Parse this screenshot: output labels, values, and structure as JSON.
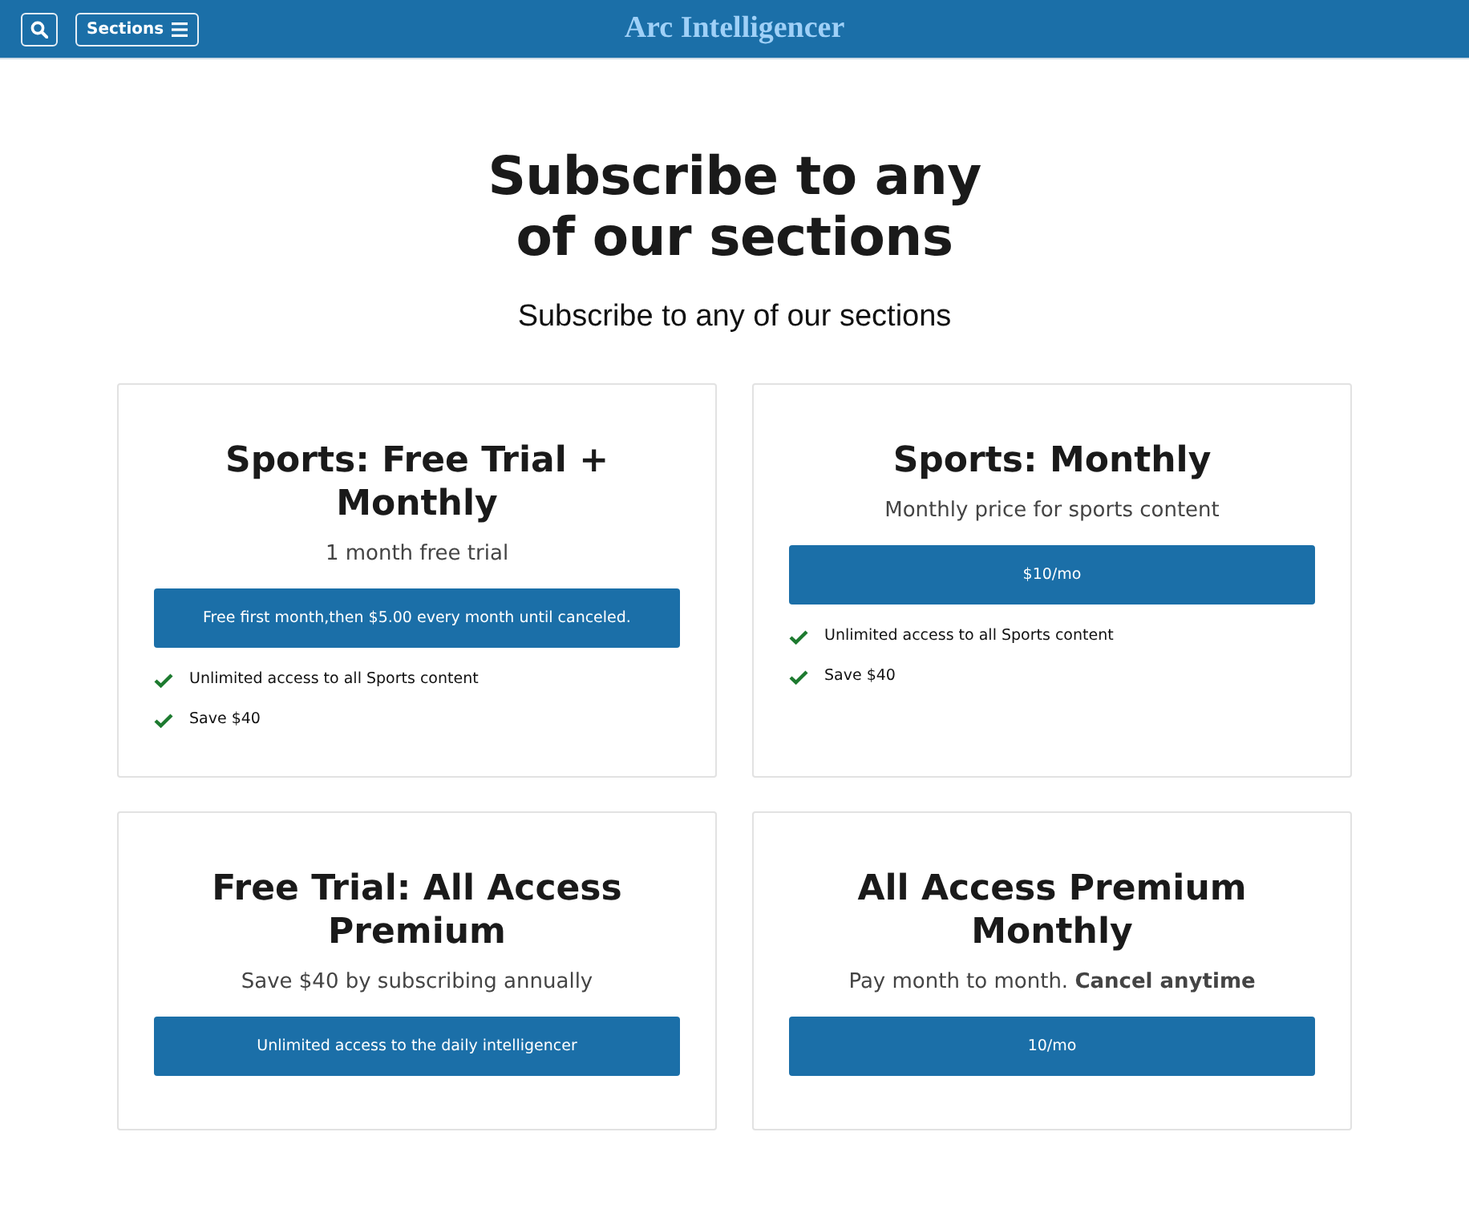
{
  "header": {
    "sections_button": {
      "label": "Sections"
    },
    "logo": "Arc Intelligencer"
  },
  "page": {
    "title": "Subscribe to any of our sections",
    "subtitle": "Subscribe to any of our sections"
  },
  "offers": [
    {
      "title": "Sports: Free Trial + Monthly",
      "description": "1 month free trial",
      "button": "Free first month,then $5.00 every month until canceled.",
      "features": [
        "Unlimited access to all Sports content",
        "Save $40"
      ]
    },
    {
      "title": "Sports: Monthly",
      "description": "Monthly price for sports content",
      "button": "$10/mo",
      "features": [
        "Unlimited access to all Sports content",
        "Save $40"
      ]
    },
    {
      "title": "Free Trial: All Access Premium",
      "description": "Save $40 by subscribing annually",
      "button": "Unlimited access to the daily intelligencer"
    },
    {
      "title": "All Access Premium Monthly",
      "description": "Pay month to month. **Cancel anytime**",
      "button": "10/mo"
    }
  ]
}
